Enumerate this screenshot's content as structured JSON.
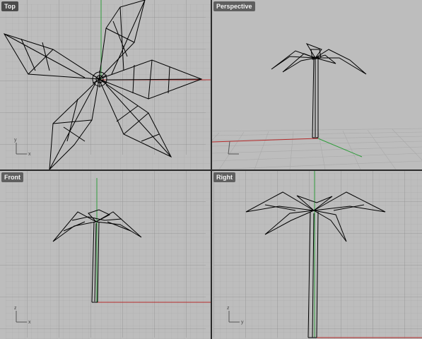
{
  "viewports": {
    "top": {
      "label": "Top"
    },
    "perspective": {
      "label": "Perspective"
    },
    "front": {
      "label": "Front"
    },
    "right": {
      "label": "Right"
    }
  },
  "axes": {
    "x": "x",
    "y": "y",
    "z": "z"
  },
  "colors": {
    "viewport_bg": "#bdbdbd",
    "grid_minor": "#a9a9a9",
    "grid_major": "#8f8f8f",
    "x_axis": "#b52a2a",
    "y_axis": "#2e9c3a",
    "wireframe": "#000000",
    "border": "#2b2b2b"
  }
}
